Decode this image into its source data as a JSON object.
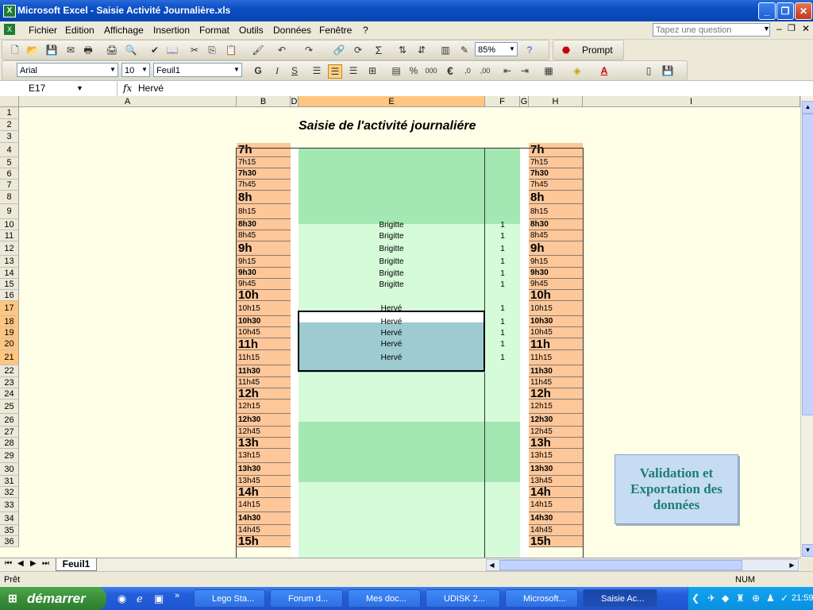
{
  "window": {
    "title": "Microsoft Excel - Saisie Activité Journalière.xls",
    "app_icon": "X"
  },
  "menu": [
    "Fichier",
    "Edition",
    "Affichage",
    "Insertion",
    "Format",
    "Outils",
    "Données",
    "Fenêtre",
    "?"
  ],
  "ask_box": {
    "placeholder": "Tapez une question"
  },
  "toolbar": {
    "zoom": "85%",
    "prompt_label": "Prompt",
    "font_name": "Arial",
    "font_size": "10",
    "sheet_combo": "Feuil1",
    "sigma": "Σ",
    "euro": "€"
  },
  "formula_bar": {
    "cell_ref": "E17",
    "fx": "fx",
    "content": "Hervé"
  },
  "columns": [
    "A",
    "B",
    "D",
    "E",
    "F",
    "G",
    "H",
    "I"
  ],
  "sheet": {
    "title": "Saisie de l'activité journaliére",
    "rows": [
      {
        "n": "1"
      },
      {
        "n": "2"
      },
      {
        "n": "3"
      },
      {
        "n": "4",
        "time": "7h",
        "style": "big"
      },
      {
        "n": "5",
        "time": "7h15",
        "style": "normal"
      },
      {
        "n": "6",
        "time": "7h30",
        "style": "bold"
      },
      {
        "n": "7",
        "time": "7h45",
        "style": "normal"
      },
      {
        "n": "8",
        "time": "8h",
        "style": "big"
      },
      {
        "n": "9",
        "time": "8h15",
        "style": "normal"
      },
      {
        "n": "10",
        "time": "8h30",
        "style": "bold",
        "name": "Brigitte",
        "count": "1"
      },
      {
        "n": "11",
        "time": "8h45",
        "style": "normal",
        "name": "Brigitte",
        "count": "1"
      },
      {
        "n": "12",
        "time": "9h",
        "style": "big",
        "name": "Brigitte",
        "count": "1"
      },
      {
        "n": "13",
        "time": "9h15",
        "style": "normal",
        "name": "Brigitte",
        "count": "1"
      },
      {
        "n": "14",
        "time": "9h30",
        "style": "bold",
        "name": "Brigitte",
        "count": "1"
      },
      {
        "n": "15",
        "time": "9h45",
        "style": "normal",
        "name": "Brigitte",
        "count": "1"
      },
      {
        "n": "16",
        "time": "10h",
        "style": "big"
      },
      {
        "n": "17",
        "time": "10h15",
        "style": "normal",
        "name": "Hervé",
        "count": "1"
      },
      {
        "n": "18",
        "time": "10h30",
        "style": "bold",
        "name": "Hervé",
        "count": "1"
      },
      {
        "n": "19",
        "time": "10h45",
        "style": "normal",
        "name": "Hervé",
        "count": "1"
      },
      {
        "n": "20",
        "time": "11h",
        "style": "big",
        "name": "Hervé",
        "count": "1"
      },
      {
        "n": "21",
        "time": "11h15",
        "style": "normal",
        "name": "Hervé",
        "count": "1"
      },
      {
        "n": "22",
        "time": "11h30",
        "style": "bold"
      },
      {
        "n": "23",
        "time": "11h45",
        "style": "normal"
      },
      {
        "n": "24",
        "time": "12h",
        "style": "big"
      },
      {
        "n": "25",
        "time": "12h15",
        "style": "normal"
      },
      {
        "n": "26",
        "time": "12h30",
        "style": "bold"
      },
      {
        "n": "27",
        "time": "12h45",
        "style": "normal"
      },
      {
        "n": "28",
        "time": "13h",
        "style": "big"
      },
      {
        "n": "29",
        "time": "13h15",
        "style": "normal"
      },
      {
        "n": "30",
        "time": "13h30",
        "style": "bold"
      },
      {
        "n": "31",
        "time": "13h45",
        "style": "normal"
      },
      {
        "n": "32",
        "time": "14h",
        "style": "big"
      },
      {
        "n": "33",
        "time": "14h15",
        "style": "normal"
      },
      {
        "n": "34",
        "time": "14h30",
        "style": "bold"
      },
      {
        "n": "35",
        "time": "14h45",
        "style": "normal"
      },
      {
        "n": "36",
        "time": "15h",
        "style": "big"
      }
    ],
    "validation_button": "Validation et Exportation des données",
    "colors": {
      "time_bg": "#fdc79a",
      "band_dark": "#a3e8b3",
      "band_light": "#d6fbd9",
      "selection": "#9dcbd0"
    }
  },
  "sheet_tab": "Feuil1",
  "status": {
    "left": "Prêt",
    "num": "NUM"
  },
  "taskbar": {
    "start": "démarrer",
    "items": [
      "Lego Sta...",
      "Forum d...",
      "Mes doc...",
      "UDISK 2...",
      "Microsoft...",
      "Saisie Ac..."
    ],
    "clock": "21:59"
  }
}
